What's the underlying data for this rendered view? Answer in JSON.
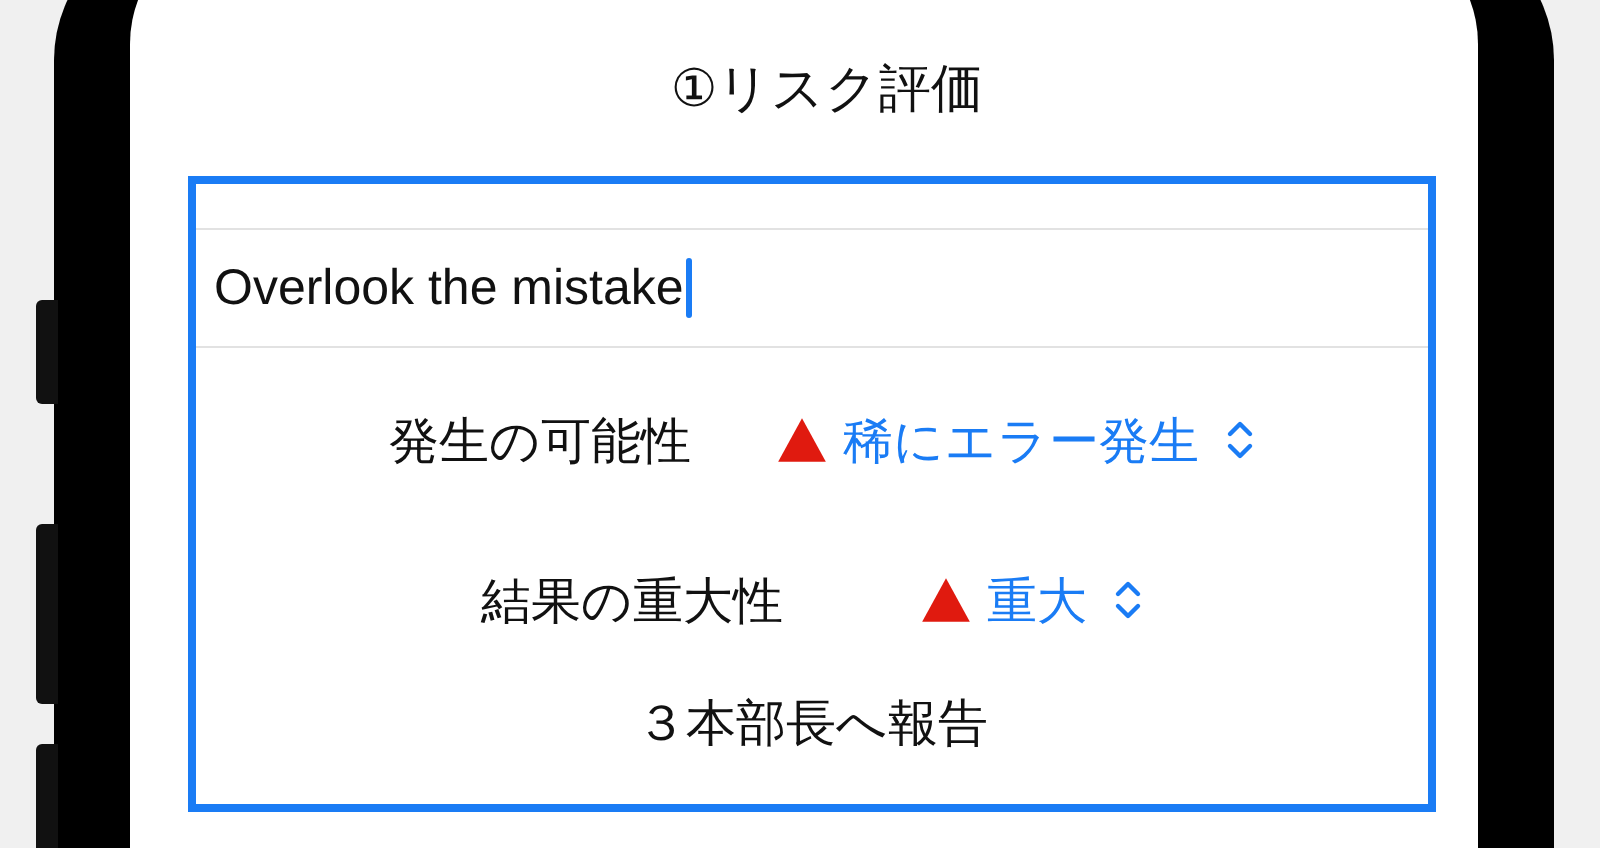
{
  "title": "①リスク評価",
  "text_field": {
    "value": "Overlook the mistake",
    "focused": true
  },
  "pickers": [
    {
      "label": "発生の可能性",
      "value": "稀にエラー発生"
    },
    {
      "label": "結果の重大性",
      "value": "重大"
    }
  ],
  "result": "３本部長へ報告"
}
